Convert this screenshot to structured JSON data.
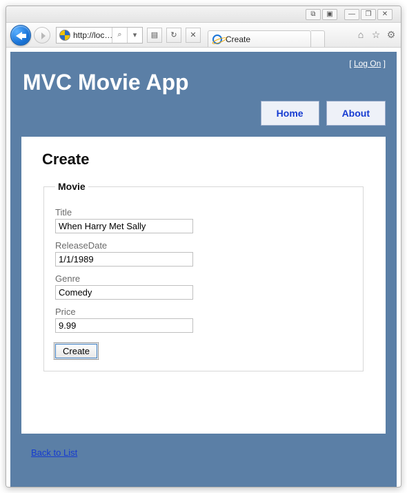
{
  "window": {
    "controls": {
      "tab_overview": "⧉",
      "pin": "▣",
      "minimize": "—",
      "restore": "❐",
      "close": "✕"
    }
  },
  "toolbar": {
    "address": "http://loc…",
    "search_hint": "⌕",
    "dropdown_glyph": "▾",
    "refresh_glyph": "↻",
    "stop_glyph": "✕",
    "page_glyph": "▤"
  },
  "tab": {
    "title": "Create"
  },
  "tool_icons": {
    "home": "⌂",
    "favorites": "☆",
    "tools": "⚙"
  },
  "header": {
    "logon_open": "[",
    "logon_label": "Log On",
    "logon_close": "]",
    "app_title": "MVC Movie App"
  },
  "menu": {
    "home": "Home",
    "about": "About"
  },
  "content": {
    "heading": "Create",
    "legend": "Movie",
    "fields": {
      "title": {
        "label": "Title",
        "value": "When Harry Met Sally"
      },
      "release_date": {
        "label": "ReleaseDate",
        "value": "1/1/1989"
      },
      "genre": {
        "label": "Genre",
        "value": "Comedy"
      },
      "price": {
        "label": "Price",
        "value": "9.99"
      }
    },
    "submit_label": "Create",
    "back_link": "Back to List"
  }
}
